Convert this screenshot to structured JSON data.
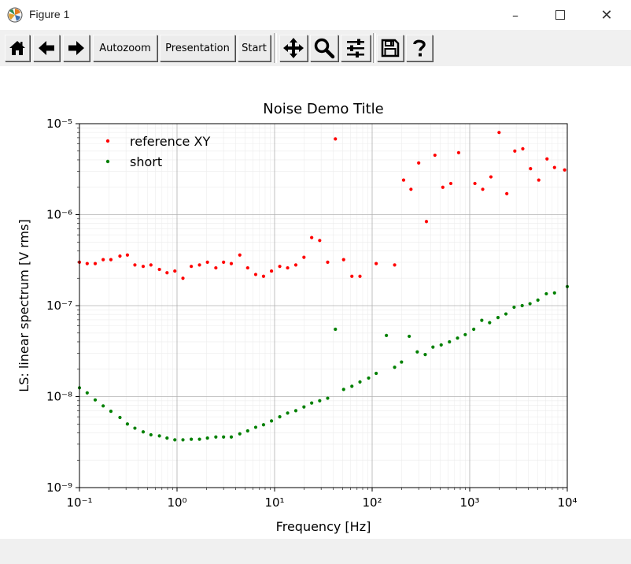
{
  "window": {
    "title": "Figure 1"
  },
  "toolbar": {
    "home_icon": "home-icon",
    "back_icon": "back-arrow-icon",
    "forward_icon": "forward-arrow-icon",
    "autozoom_label": "Autozoom",
    "presentation_label": "Presentation",
    "start_label": "Start",
    "pan_icon": "move-icon",
    "zoom_icon": "magnifier-icon",
    "configure_icon": "sliders-icon",
    "save_icon": "floppy-disk-icon",
    "help_icon": "question-mark-icon"
  },
  "chart_data": {
    "type": "scatter",
    "title": "Noise Demo Title",
    "xlabel": "Frequency [Hz]",
    "ylabel": "LS: linear spectrum [V rms]",
    "xscale": "log",
    "yscale": "log",
    "xlim": [
      0.1,
      10000
    ],
    "ylim": [
      1e-09,
      1e-05
    ],
    "grid": "major and minor",
    "legend": "upper-left",
    "x_tick_labels": [
      "10⁻¹",
      "10⁰",
      "10¹",
      "10²",
      "10³",
      "10⁴"
    ],
    "y_tick_labels": [
      "10⁻⁹",
      "10⁻⁸",
      "10⁻⁷",
      "10⁻⁶",
      "10⁻⁵"
    ],
    "series": [
      {
        "name": "reference XY",
        "color": "#ff0000",
        "points": [
          [
            0.1,
            3e-07
          ],
          [
            0.12,
            2.9e-07
          ],
          [
            0.145,
            2.9e-07
          ],
          [
            0.175,
            3.2e-07
          ],
          [
            0.21,
            3.2e-07
          ],
          [
            0.26,
            3.5e-07
          ],
          [
            0.31,
            3.6e-07
          ],
          [
            0.37,
            2.8e-07
          ],
          [
            0.45,
            2.7e-07
          ],
          [
            0.54,
            2.8e-07
          ],
          [
            0.66,
            2.5e-07
          ],
          [
            0.79,
            2.3e-07
          ],
          [
            0.95,
            2.4e-07
          ],
          [
            1.15,
            2e-07
          ],
          [
            1.4,
            2.7e-07
          ],
          [
            1.7,
            2.8e-07
          ],
          [
            2.05,
            3e-07
          ],
          [
            2.5,
            2.6e-07
          ],
          [
            3.0,
            3e-07
          ],
          [
            3.6,
            2.9e-07
          ],
          [
            4.4,
            3.6e-07
          ],
          [
            5.3,
            2.6e-07
          ],
          [
            6.4,
            2.2e-07
          ],
          [
            7.7,
            2.1e-07
          ],
          [
            9.3,
            2.4e-07
          ],
          [
            11.3,
            2.7e-07
          ],
          [
            13.6,
            2.6e-07
          ],
          [
            16.5,
            2.8e-07
          ],
          [
            20,
            3.4e-07
          ],
          [
            24,
            5.6e-07
          ],
          [
            29,
            5.2e-07
          ],
          [
            35,
            3e-07
          ],
          [
            42,
            6.8e-06
          ],
          [
            51,
            3.2e-07
          ],
          [
            62,
            2.1e-07
          ],
          [
            75,
            2.1e-07
          ],
          [
            110,
            2.9e-07
          ],
          [
            170,
            2.8e-07
          ],
          [
            210,
            2.4e-06
          ],
          [
            250,
            1.9e-06
          ],
          [
            300,
            3.7e-06
          ],
          [
            360,
            8.4e-07
          ],
          [
            440,
            4.5e-06
          ],
          [
            530,
            2e-06
          ],
          [
            640,
            2.2e-06
          ],
          [
            770,
            4.8e-06
          ],
          [
            1130,
            2.2e-06
          ],
          [
            1360,
            1.9e-06
          ],
          [
            1650,
            2.6e-06
          ],
          [
            2000,
            8e-06
          ],
          [
            2400,
            1.7e-06
          ],
          [
            2900,
            5e-06
          ],
          [
            3500,
            5.3e-06
          ],
          [
            4200,
            3.2e-06
          ],
          [
            5100,
            2.4e-06
          ],
          [
            6200,
            4.1e-06
          ],
          [
            7400,
            3.3e-06
          ],
          [
            9400,
            3.1e-06
          ]
        ]
      },
      {
        "name": "short",
        "color": "#008000",
        "points": [
          [
            0.1,
            1.25e-08
          ],
          [
            0.12,
            1.1e-08
          ],
          [
            0.145,
            9.2e-09
          ],
          [
            0.175,
            7.9e-09
          ],
          [
            0.21,
            6.9e-09
          ],
          [
            0.26,
            5.9e-09
          ],
          [
            0.31,
            5e-09
          ],
          [
            0.37,
            4.5e-09
          ],
          [
            0.45,
            4.1e-09
          ],
          [
            0.54,
            3.8e-09
          ],
          [
            0.66,
            3.7e-09
          ],
          [
            0.79,
            3.5e-09
          ],
          [
            0.95,
            3.35e-09
          ],
          [
            1.15,
            3.35e-09
          ],
          [
            1.4,
            3.4e-09
          ],
          [
            1.7,
            3.4e-09
          ],
          [
            2.05,
            3.5e-09
          ],
          [
            2.5,
            3.6e-09
          ],
          [
            3.0,
            3.6e-09
          ],
          [
            3.6,
            3.6e-09
          ],
          [
            4.4,
            3.9e-09
          ],
          [
            5.3,
            4.2e-09
          ],
          [
            6.4,
            4.6e-09
          ],
          [
            7.7,
            4.9e-09
          ],
          [
            9.3,
            5.4e-09
          ],
          [
            11.3,
            6e-09
          ],
          [
            13.6,
            6.6e-09
          ],
          [
            16.5,
            7e-09
          ],
          [
            20,
            7.7e-09
          ],
          [
            24,
            8.5e-09
          ],
          [
            29,
            9e-09
          ],
          [
            35,
            9.6e-09
          ],
          [
            42,
            5.5e-08
          ],
          [
            51,
            1.2e-08
          ],
          [
            62,
            1.3e-08
          ],
          [
            75,
            1.45e-08
          ],
          [
            92,
            1.6e-08
          ],
          [
            110,
            1.8e-08
          ],
          [
            140,
            4.7e-08
          ],
          [
            170,
            2.1e-08
          ],
          [
            200,
            2.4e-08
          ],
          [
            240,
            4.6e-08
          ],
          [
            290,
            3.1e-08
          ],
          [
            350,
            2.9e-08
          ],
          [
            420,
            3.5e-08
          ],
          [
            510,
            3.7e-08
          ],
          [
            620,
            4e-08
          ],
          [
            750,
            4.4e-08
          ],
          [
            900,
            4.8e-08
          ],
          [
            1100,
            5.5e-08
          ],
          [
            1330,
            6.9e-08
          ],
          [
            1600,
            6.5e-08
          ],
          [
            1950,
            7.4e-08
          ],
          [
            2350,
            8.1e-08
          ],
          [
            2850,
            9.6e-08
          ],
          [
            3450,
            1e-07
          ],
          [
            4150,
            1.05e-07
          ],
          [
            5000,
            1.15e-07
          ],
          [
            6100,
            1.35e-07
          ],
          [
            7400,
            1.38e-07
          ],
          [
            10000,
            1.62e-07
          ]
        ]
      }
    ]
  }
}
